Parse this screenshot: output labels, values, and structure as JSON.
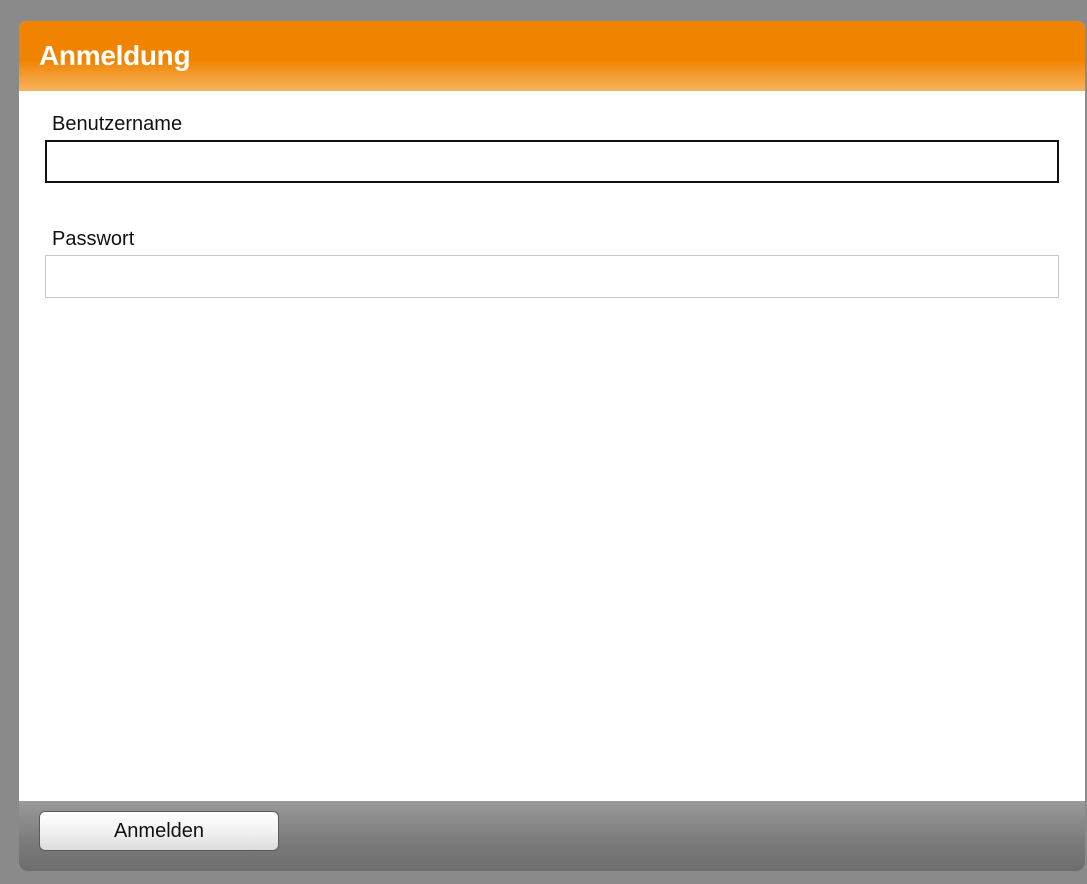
{
  "dialog": {
    "title": "Anmeldung"
  },
  "form": {
    "username": {
      "label": "Benutzername",
      "value": "",
      "placeholder": ""
    },
    "password": {
      "label": "Passwort",
      "value": "",
      "placeholder": ""
    }
  },
  "footer": {
    "login_label": "Anmelden"
  },
  "colors": {
    "header_orange": "#f08300",
    "footer_gray": "#7a7a7a",
    "background": "#8a8a8a"
  }
}
